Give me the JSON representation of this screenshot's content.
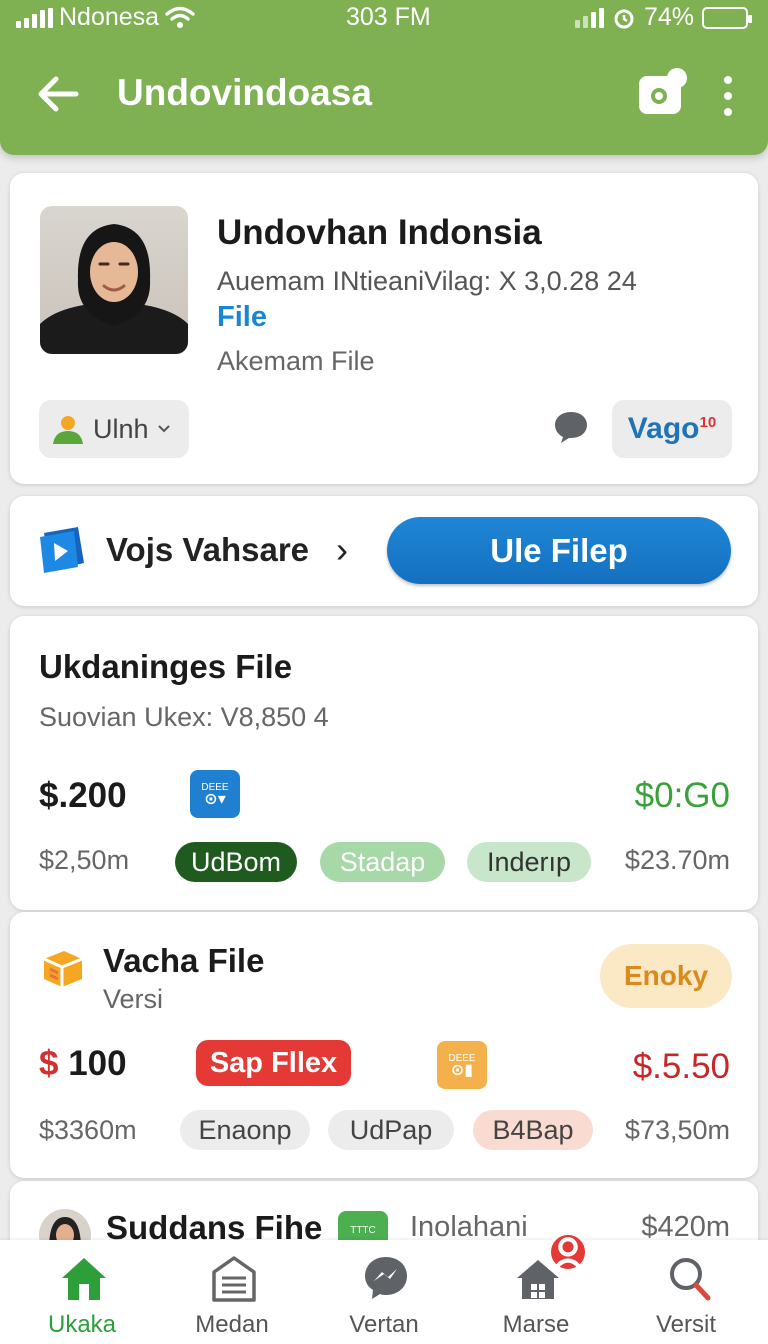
{
  "status_bar": {
    "carrier": "Ndonesa",
    "time": "303 FM",
    "battery": "74%"
  },
  "app_bar": {
    "title": "Undovindoasa"
  },
  "profile": {
    "name": "Undovhan Indonsia",
    "subtitle": "Auemam INtieaniVilag:  X 3,0.28 24",
    "link": "File",
    "meta": "Akemam File",
    "user_chip": "Ulnh",
    "vago_chip": "Vago",
    "vago_sup": "10"
  },
  "action_row": {
    "label": "Vojs Vahsare",
    "button": "Ule Filep"
  },
  "file1": {
    "title": "Ukdaninges File",
    "subtitle": "Suovian Ukex:  V8,850  4",
    "price_left": "$.200",
    "badge": "DEEE",
    "price_right": "$0:G0",
    "amount_left": "$2,50m",
    "tags": [
      "UdBom",
      "Stadap",
      "Inderıp"
    ],
    "amount_right": "$23.70m"
  },
  "file2": {
    "title": "Vacha File",
    "subtitle": "Versi",
    "status": "Enoky",
    "price_symbol": "$",
    "price_value": "100",
    "tag_primary": "Sap Fllex",
    "badge": "DEEE",
    "price_right": "$.5.50",
    "amount_left": "$3360m",
    "tags": [
      "Enaonp",
      "UdPap",
      "B4Bap"
    ],
    "amount_right": "$73,50m"
  },
  "file3": {
    "title": "Suddans Fihe",
    "badge": "TTTC",
    "subtitle": "Inolahani",
    "amount_right": "$420m"
  },
  "bottom_nav": {
    "items": [
      "Ukaka",
      "Medan",
      "Vertan",
      "Marse",
      "Versit"
    ],
    "active": "Ukaka",
    "badge_icon": "user-icon"
  },
  "colors": {
    "brand_green": "#7fb153",
    "primary_blue": "#1a7bcc",
    "accent_red": "#e53935",
    "price_green": "#3aa03a",
    "price_red": "#c62828"
  }
}
